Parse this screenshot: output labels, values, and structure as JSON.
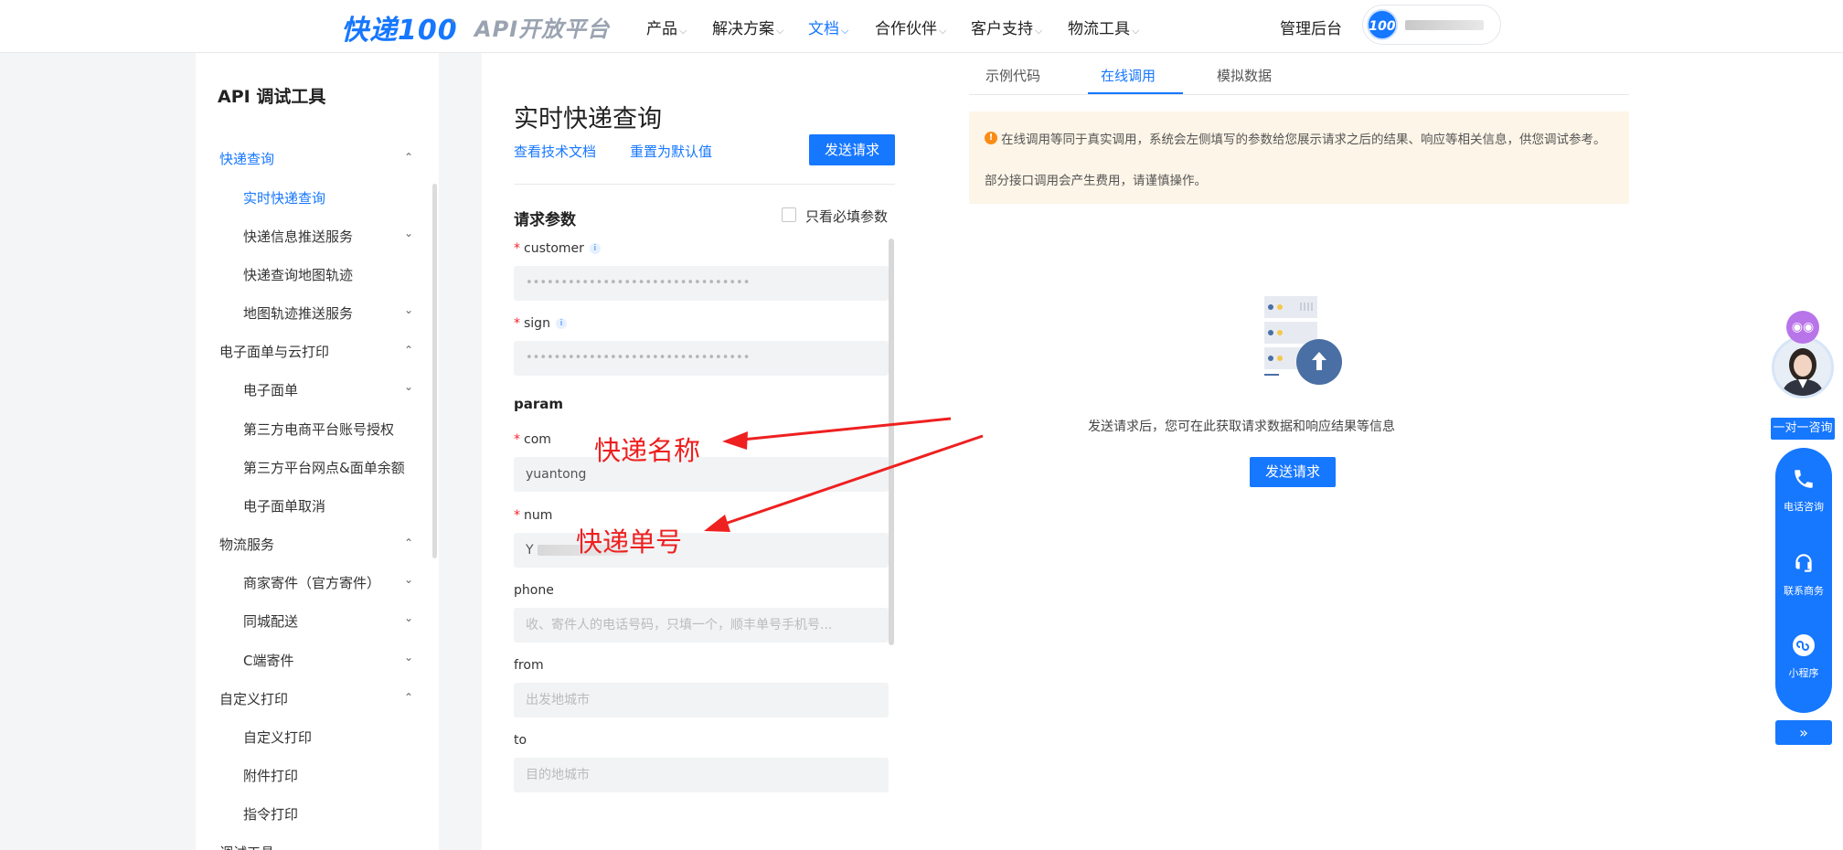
{
  "header": {
    "logo_text": "快递100",
    "logo_dot": "·",
    "logo_sub": "API开放平台",
    "nav": [
      {
        "label": "产品",
        "active": false
      },
      {
        "label": "解决方案",
        "active": false
      },
      {
        "label": "文档",
        "active": true
      },
      {
        "label": "合作伙伴",
        "active": false
      },
      {
        "label": "客户支持",
        "active": false
      },
      {
        "label": "物流工具",
        "active": false
      }
    ],
    "admin": "管理后台",
    "user_logo": "100"
  },
  "sidebar": {
    "title": "API 调试工具",
    "groups": [
      {
        "label": "快递查询",
        "active": true
      },
      {
        "label": "电子面单与云打印"
      },
      {
        "label": "物流服务"
      },
      {
        "label": "自定义打印"
      },
      {
        "label": "调试工具"
      }
    ],
    "items": [
      {
        "label": "实时快递查询",
        "active": true
      },
      {
        "label": "快递信息推送服务"
      },
      {
        "label": "快递查询地图轨迹"
      },
      {
        "label": "地图轨迹推送服务"
      },
      {
        "label": "电子面单"
      },
      {
        "label": "第三方电商平台账号授权"
      },
      {
        "label": "第三方平台网点&面单余额"
      },
      {
        "label": "电子面单取消"
      },
      {
        "label": "商家寄件（官方寄件）"
      },
      {
        "label": "同城配送"
      },
      {
        "label": "C端寄件"
      },
      {
        "label": "自定义打印"
      },
      {
        "label": "附件打印"
      },
      {
        "label": "指令打印"
      }
    ]
  },
  "form": {
    "title": "实时快递查询",
    "link_docs": "查看技术文档",
    "link_reset": "重置为默认值",
    "send_button": "发送请求",
    "section_title": "请求参数",
    "required_only_label": "只看必填参数",
    "required_mark": "*",
    "fields": {
      "customer": {
        "label": "customer",
        "value": "••••••••••••••••••••••••••••••••"
      },
      "sign": {
        "label": "sign",
        "value": "••••••••••••••••••••••••••••••••"
      },
      "param_title": "param",
      "com": {
        "label": "com",
        "value": "yuantong"
      },
      "num": {
        "label": "num",
        "value": "Y"
      },
      "phone": {
        "label": "phone",
        "placeholder": "收、寄件人的电话号码，只填一个，顺丰单号手机号..."
      },
      "from": {
        "label": "from",
        "placeholder": "出发地城市"
      },
      "to": {
        "label": "to",
        "placeholder": "目的地城市"
      }
    }
  },
  "result": {
    "tabs": [
      {
        "label": "示例代码",
        "active": false
      },
      {
        "label": "在线调用",
        "active": true
      },
      {
        "label": "模拟数据",
        "active": false
      }
    ],
    "notice_line1": "在线调用等同于真实调用，系统会左侧填写的参数给您展示请求之后的结果、响应等相关信息，供您调试参考。",
    "notice_line2": "部分接口调用会产生费用，请谨慎操作。",
    "empty_caption": "发送请求后，您可在此获取请求数据和响应结果等信息",
    "send_button": "发送请求"
  },
  "annotations": {
    "com_label": "快递名称",
    "num_label": "快递单号"
  },
  "floatbar": {
    "consult": "一对一咨询",
    "phone": "电话咨询",
    "business": "联系商务",
    "miniapp": "小程序",
    "expand": "»"
  },
  "colors": {
    "primary": "#1677ff",
    "annotation": "#ee2020",
    "notice_bg": "#fdf5e7",
    "warning": "#fa8c16"
  }
}
